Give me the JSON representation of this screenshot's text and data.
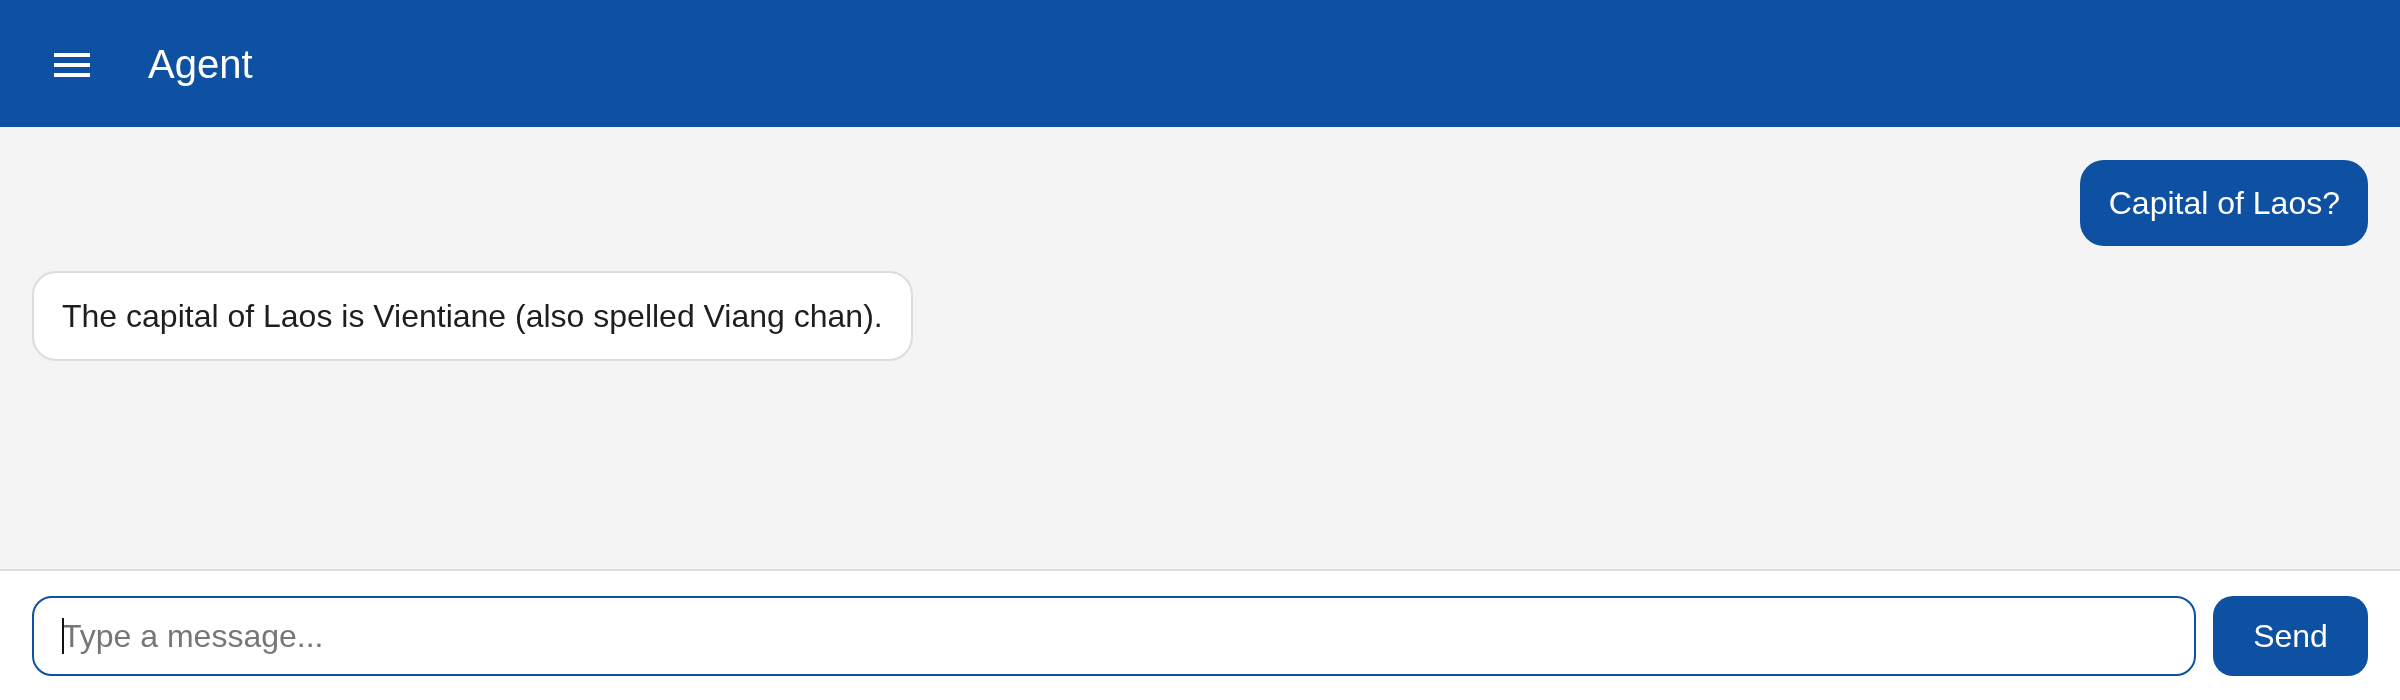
{
  "header": {
    "title": "Agent"
  },
  "messages": [
    {
      "kind": "user",
      "text": "Capital of Laos?"
    },
    {
      "kind": "assistant",
      "text": "The capital of Laos is Vientiane (also spelled Viang chan)."
    }
  ],
  "composer": {
    "placeholder": "Type a message...",
    "focused": true,
    "send_label": "Send"
  }
}
